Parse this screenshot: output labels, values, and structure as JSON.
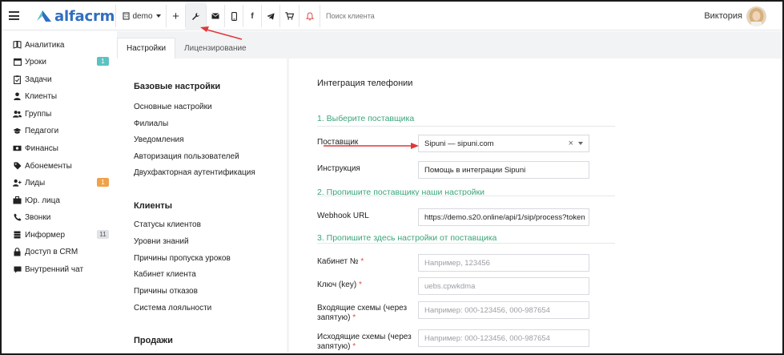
{
  "app": {
    "logo_text": "alfacrm",
    "branch": "demo",
    "search_placeholder": "Поиск клиента",
    "user_name": "Виктория",
    "toolbar_icons": [
      "plus-icon",
      "wrench-icon",
      "mail-icon",
      "phone-icon",
      "facebook-icon",
      "telegram-icon",
      "cart-icon",
      "bell-icon"
    ]
  },
  "sidebar": {
    "items": [
      {
        "label": "Аналитика",
        "icon": "analytics-icon"
      },
      {
        "label": "Уроки",
        "icon": "calendar-icon",
        "badge": "1",
        "badge_color": "#5bc2c1"
      },
      {
        "label": "Задачи",
        "icon": "tasks-icon"
      },
      {
        "label": "Клиенты",
        "icon": "user-icon"
      },
      {
        "label": "Группы",
        "icon": "group-icon"
      },
      {
        "label": "Педагоги",
        "icon": "graduation-cap-icon"
      },
      {
        "label": "Финансы",
        "icon": "money-icon"
      },
      {
        "label": "Абонементы",
        "icon": "tag-icon"
      },
      {
        "label": "Лиды",
        "icon": "add-user-icon",
        "badge": "1",
        "badge_color": "#f0a24a"
      },
      {
        "label": "Юр. лица",
        "icon": "briefcase-icon"
      },
      {
        "label": "Звонки",
        "icon": "phone-icon"
      },
      {
        "label": "Информер",
        "icon": "database-icon",
        "badge": "11",
        "badge_color": "#dfe2e6"
      },
      {
        "label": "Доступ в CRM",
        "icon": "lock-icon"
      },
      {
        "label": "Внутренний чат",
        "icon": "chat-icon"
      }
    ]
  },
  "tabs": [
    {
      "label": "Настройки",
      "active": true
    },
    {
      "label": "Лицензирование",
      "active": false
    }
  ],
  "settings_menu": {
    "basic_title": "Базовые настройки",
    "basic_items": [
      "Основные настройки",
      "Филиалы",
      "Уведомления",
      "Авторизация пользователей",
      "Двухфакторная аутентификация"
    ],
    "clients_title": "Клиенты",
    "clients_items": [
      "Статусы клиентов",
      "Уровни знаний",
      "Причины пропуска уроков",
      "Кабинет клиента",
      "Причины отказов",
      "Система лояльности"
    ],
    "sales_title": "Продажи"
  },
  "panel": {
    "title": "Интеграция телефонии",
    "section1": "1. Выберите поставщика",
    "provider_label": "Поставщик",
    "provider_value": "Sipuni — sipuni.com",
    "clear_symbol": "×",
    "instruction_label": "Инструкция",
    "instruction_value": "Помощь в интеграции Sipuni",
    "section2": "2. Пропишите поставщику наши настройки",
    "webhook_label": "Webhook URL",
    "webhook_value": "https://demo.s20.online/api/1/sip/process?token",
    "section3": "3. Пропишите здесь настройки от поставщика",
    "cabinet_label": "Кабинет №",
    "cabinet_placeholder": "Например, 123456",
    "key_label": "Ключ (key)",
    "key_placeholder": "uebs.cpwkdma",
    "incoming_label_1": "Входящие схемы (через",
    "incoming_label_2": "запятую)",
    "incoming_placeholder": "Например: 000-123456, 000-987654",
    "outgoing_label_1": "Исходящие схемы (через",
    "outgoing_label_2": "запятую)",
    "outgoing_placeholder": "Например: 000-123456, 000-987654",
    "required_mark": "*"
  },
  "colors": {
    "brand": "#2f6ec0",
    "section": "#3aa57a",
    "annotation_arrow": "#e0373a",
    "required": "#e14b4b"
  }
}
